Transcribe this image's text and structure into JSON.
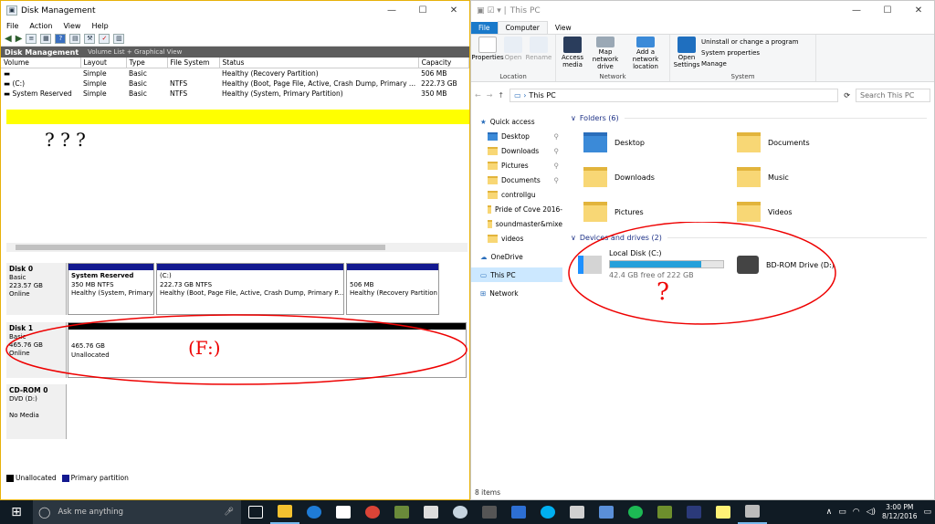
{
  "disk_mgmt": {
    "title": "Disk Management",
    "menu": [
      "File",
      "Action",
      "View",
      "Help"
    ],
    "panel_title": "Disk Management",
    "view_label": "Volume List + Graphical View",
    "columns": [
      "Volume",
      "Layout",
      "Type",
      "File System",
      "Status",
      "Capacity"
    ],
    "volumes": [
      [
        "",
        "Simple",
        "Basic",
        "",
        "Healthy (Recovery Partition)",
        "506 MB"
      ],
      [
        "(C:)",
        "Simple",
        "Basic",
        "NTFS",
        "Healthy (Boot, Page File, Active, Crash Dump, Primary ...",
        "222.73 GB"
      ],
      [
        "System Reserved",
        "Simple",
        "Basic",
        "NTFS",
        "Healthy (System, Primary Partition)",
        "350 MB"
      ]
    ],
    "disks": {
      "disk0": {
        "name": "Disk 0",
        "type": "Basic",
        "size": "223.57 GB",
        "state": "Online",
        "parts": [
          {
            "title": "System Reserved",
            "size": "350 MB NTFS",
            "status": "Healthy (System, Primary"
          },
          {
            "title": "(C:)",
            "size": "222.73 GB NTFS",
            "status": "Healthy (Boot, Page File, Active, Crash Dump, Primary P..."
          },
          {
            "title": "",
            "size": "506 MB",
            "status": "Healthy (Recovery Partition"
          }
        ]
      },
      "disk1": {
        "name": "Disk 1",
        "type": "Basic",
        "size": "465.76 GB",
        "state": "Online",
        "part": {
          "size": "465.76 GB",
          "status": "Unallocated"
        }
      },
      "cdrom": {
        "name": "CD-ROM 0",
        "type": "DVD (D:)",
        "state": "No Media"
      }
    },
    "legend": [
      "Unallocated",
      "Primary partition"
    ],
    "legend_colors": [
      "#000000",
      "#131990"
    ]
  },
  "explorer": {
    "title": "This PC",
    "tabs": [
      "File",
      "Computer",
      "View"
    ],
    "ribbon": {
      "location": {
        "label": "Location",
        "buttons": [
          "Properties",
          "Open",
          "Rename"
        ]
      },
      "network": {
        "label": "Network",
        "buttons": [
          "Access media",
          "Map network drive",
          "Add a network location"
        ]
      },
      "system": {
        "label": "System",
        "buttons": [
          "Open Settings"
        ],
        "links": [
          "Uninstall or change a program",
          "System properties",
          "Manage"
        ]
      }
    },
    "address": "This PC",
    "search_placeholder": "Search This PC",
    "nav": {
      "quick_access": "Quick access",
      "items": [
        "Desktop",
        "Downloads",
        "Pictures",
        "Documents",
        "controllgu",
        "Pride of Cove 2016-",
        "soundmaster&mixe",
        "videos"
      ],
      "onedrive": "OneDrive",
      "this_pc": "This PC",
      "network": "Network"
    },
    "folders_header": "Folders (6)",
    "folders": [
      "Desktop",
      "Documents",
      "Downloads",
      "Music",
      "Pictures",
      "Videos"
    ],
    "devices_header": "Devices and drives (2)",
    "drives": [
      {
        "name": "Local Disk (C:)",
        "free": "42.4 GB free of 222 GB",
        "used_fraction": 0.81
      },
      {
        "name": "BD-ROM Drive (D:)"
      }
    ],
    "status": "8 items"
  },
  "annotations": {
    "question_marks": "? ? ?",
    "f_label": "(F:)",
    "question": "?"
  },
  "taskbar": {
    "search": "Ask me anything",
    "time": "3:00 PM",
    "date": "8/12/2016"
  }
}
